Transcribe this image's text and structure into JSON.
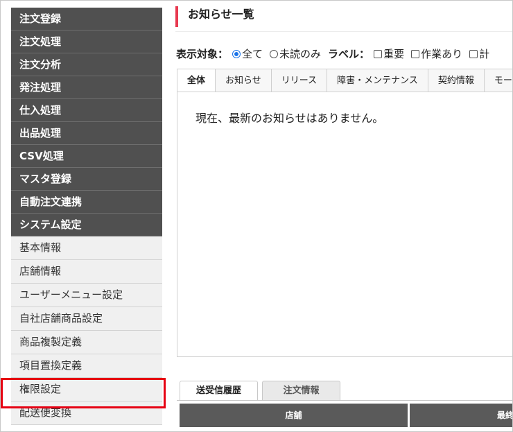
{
  "sidebar": {
    "dark_items": [
      "注文登録",
      "注文処理",
      "注文分析",
      "発注処理",
      "仕入処理",
      "出品処理",
      "CSV処理",
      "マスタ登録",
      "自動注文連携",
      "システム設定"
    ],
    "light_items": [
      "基本情報",
      "店舗情報",
      "ユーザーメニュー設定",
      "自社店舗商品設定",
      "商品複製定義",
      "項目置換定義",
      "権限設定",
      "配送便変換"
    ],
    "highlighted_item": "権限設定"
  },
  "main": {
    "title": "お知らせ一覧",
    "filter": {
      "target_label": "表示対象：",
      "radio_all": "全て",
      "radio_unread": "未読のみ",
      "label_label": "ラベル：",
      "check_important": "重要",
      "check_work": "作業あり",
      "check_partial": "計"
    },
    "tabs": [
      "全体",
      "お知らせ",
      "リリース",
      "障害・メンテナンス",
      "契約情報",
      "モー"
    ],
    "active_tab": "全体",
    "empty_message": "現在、最新のお知らせはありません。"
  },
  "bottom": {
    "tabs": [
      "送受信履歴",
      "注文情報"
    ],
    "columns": [
      "店舗",
      "最終"
    ]
  },
  "colors": {
    "accent": "#e8384f",
    "highlight": "#e60012",
    "nav_dark": "#505050"
  }
}
